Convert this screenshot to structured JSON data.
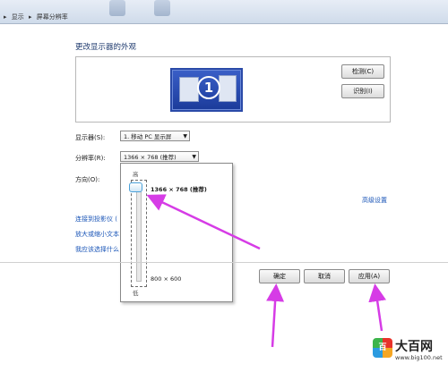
{
  "breadcrumb": {
    "items": [
      "显示",
      "屏幕分辨率"
    ]
  },
  "page": {
    "title": "更改显示器的外观"
  },
  "monitor_panel": {
    "monitor_number": "1",
    "detect_button": "检测(C)",
    "identify_button": "识别(I)"
  },
  "form": {
    "display_label": "显示器(S):",
    "display_value": "1. 移动 PC 显示屏",
    "resolution_label": "分辨率(R):",
    "resolution_value": "1366 × 768 (推荐)",
    "orientation_label": "方向(O):"
  },
  "resolution_popup": {
    "high_label": "高",
    "low_label": "低",
    "top_option": "1366 × 768 (推荐)",
    "bottom_option": "800 × 600"
  },
  "links": {
    "advanced": "高级设置",
    "projector": "连接到投影仪 (",
    "text_size": "放大或缩小文本",
    "which_settings": "我应该选择什么"
  },
  "buttons": {
    "ok": "确定",
    "cancel": "取消",
    "apply": "应用(A)"
  },
  "watermark": {
    "logo_char": "百",
    "name": "大百网",
    "url": "www.big100.net"
  },
  "colors": {
    "arrow": "#d63ce6",
    "link": "#1a55b7",
    "title": "#1e3a6e"
  }
}
